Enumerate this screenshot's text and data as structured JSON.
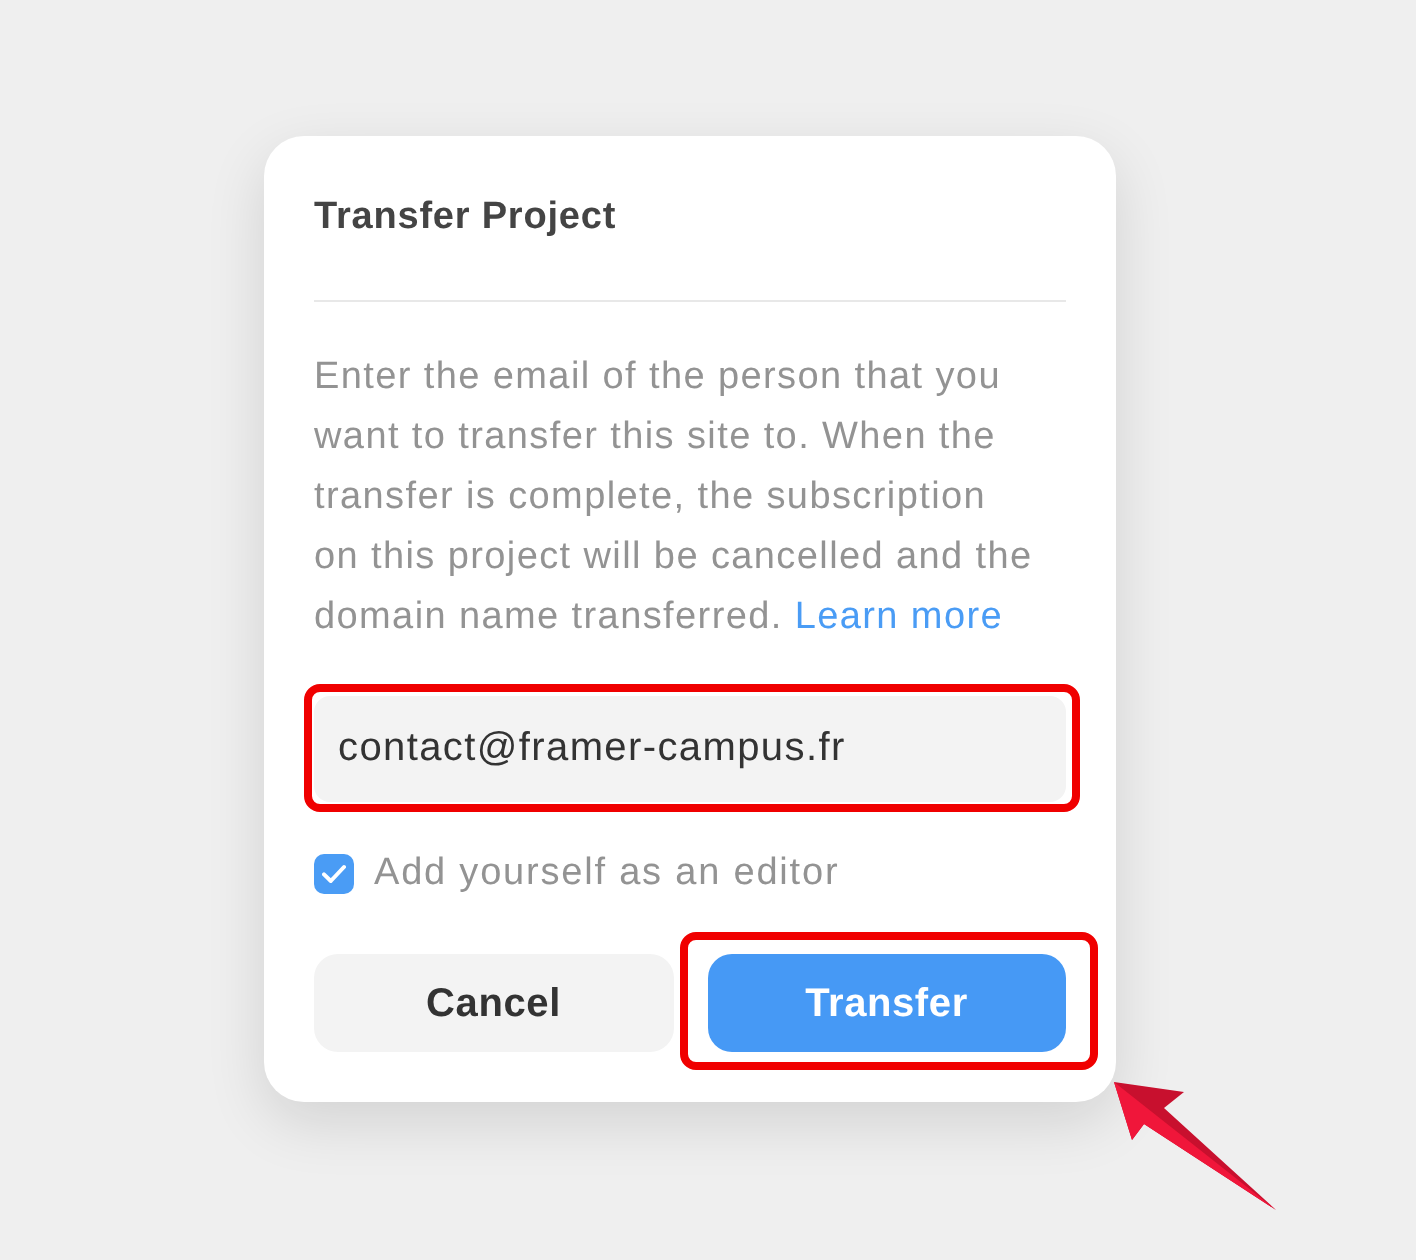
{
  "dialog": {
    "title": "Transfer Project",
    "description": "Enter the email of the person that you want to transfer this site to. When the transfer is complete, the subscription on this project will be cancelled and the domain name transferred.",
    "link": "Learn more"
  },
  "email_field": {
    "value": "contact@framer-campus.fr",
    "highlighted": true
  },
  "checkbox": {
    "label": "Add yourself as an editor",
    "checked": true
  },
  "buttons": [
    {
      "label": "Cancel",
      "kind": "secondary",
      "highlighted": false
    },
    {
      "label": "Transfer",
      "kind": "primary",
      "highlighted": true
    }
  ]
}
